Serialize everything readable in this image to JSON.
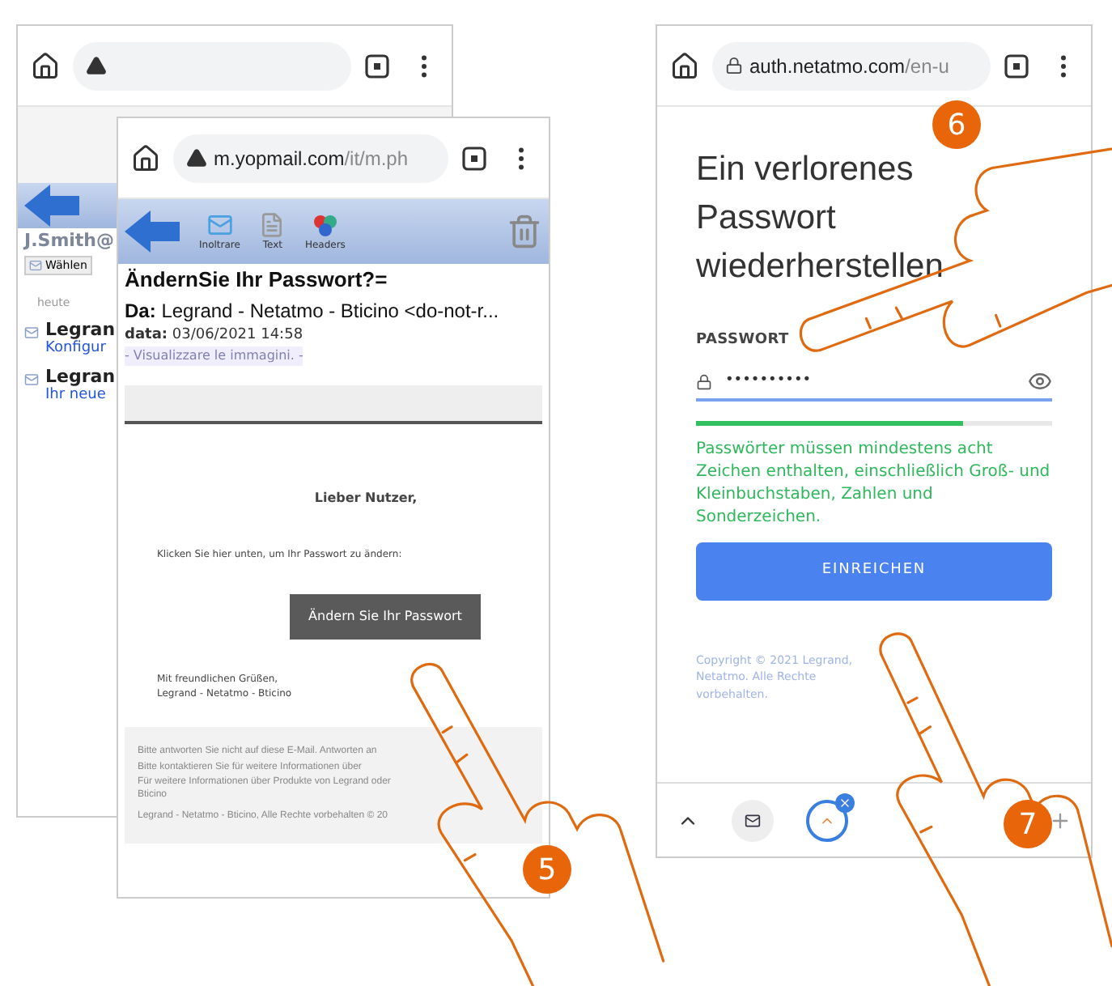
{
  "inbox_screen": {
    "account": "J.Smith@",
    "toolbar_buttons": [
      "Wählen"
    ],
    "section": "heute",
    "messages": [
      {
        "sender": "Legran",
        "preview": "Konfigur"
      },
      {
        "sender": "Legran",
        "preview": "Ihr neue"
      }
    ]
  },
  "email_screen": {
    "url": {
      "host": "m.yopmail.com",
      "path": "/it/m.ph"
    },
    "toolbar": [
      "Inoltrare",
      "Text",
      "Headers"
    ],
    "subject": "ÄndernSie Ihr Passwort?=",
    "from_label": "Da:",
    "from": "Legrand - Netatmo - Bticino <do-not-r...",
    "date_label": "data:",
    "date": "03/06/2021 14:58",
    "images_link": "- Visualizzare le immagini. -",
    "greeting": "Lieber Nutzer,",
    "instruction": "Klicken Sie hier unten, um Ihr Passwort zu ändern:",
    "button": "Ändern Sie Ihr Passwort",
    "closing": [
      "Mit freundlichen Grüßen,",
      "Legrand - Netatmo - Bticino"
    ],
    "footer": [
      "Bitte antworten Sie nicht auf diese E-Mail. Antworten an",
      "Bitte kontaktieren Sie für weitere Informationen über",
      "Für weitere Informationen über Produkte von Legrand oder Bticino",
      "Legrand - Netatmo - Bticino, Alle Rechte vorbehalten © 20"
    ],
    "step": "5"
  },
  "reset_screen": {
    "url": {
      "host": "auth.netatmo.com",
      "path": "/en-u"
    },
    "heading": "Ein verlorenes Passwort wiederherstellen",
    "field_label": "PASSWORT",
    "field_value": "••••••••••",
    "strength": {
      "level": 0.75
    },
    "hint": "Passwörter müssen mindestens acht Zeichen enthalten, einschließlich Groß- und Kleinbuchstaben, Zahlen und Sonderzeichen.",
    "button": "EINREICHEN",
    "copyright": "Copyright © 2021 Legrand, Netatmo. Alle Rechte vorbehalten.",
    "steps": [
      "6",
      "7"
    ]
  }
}
